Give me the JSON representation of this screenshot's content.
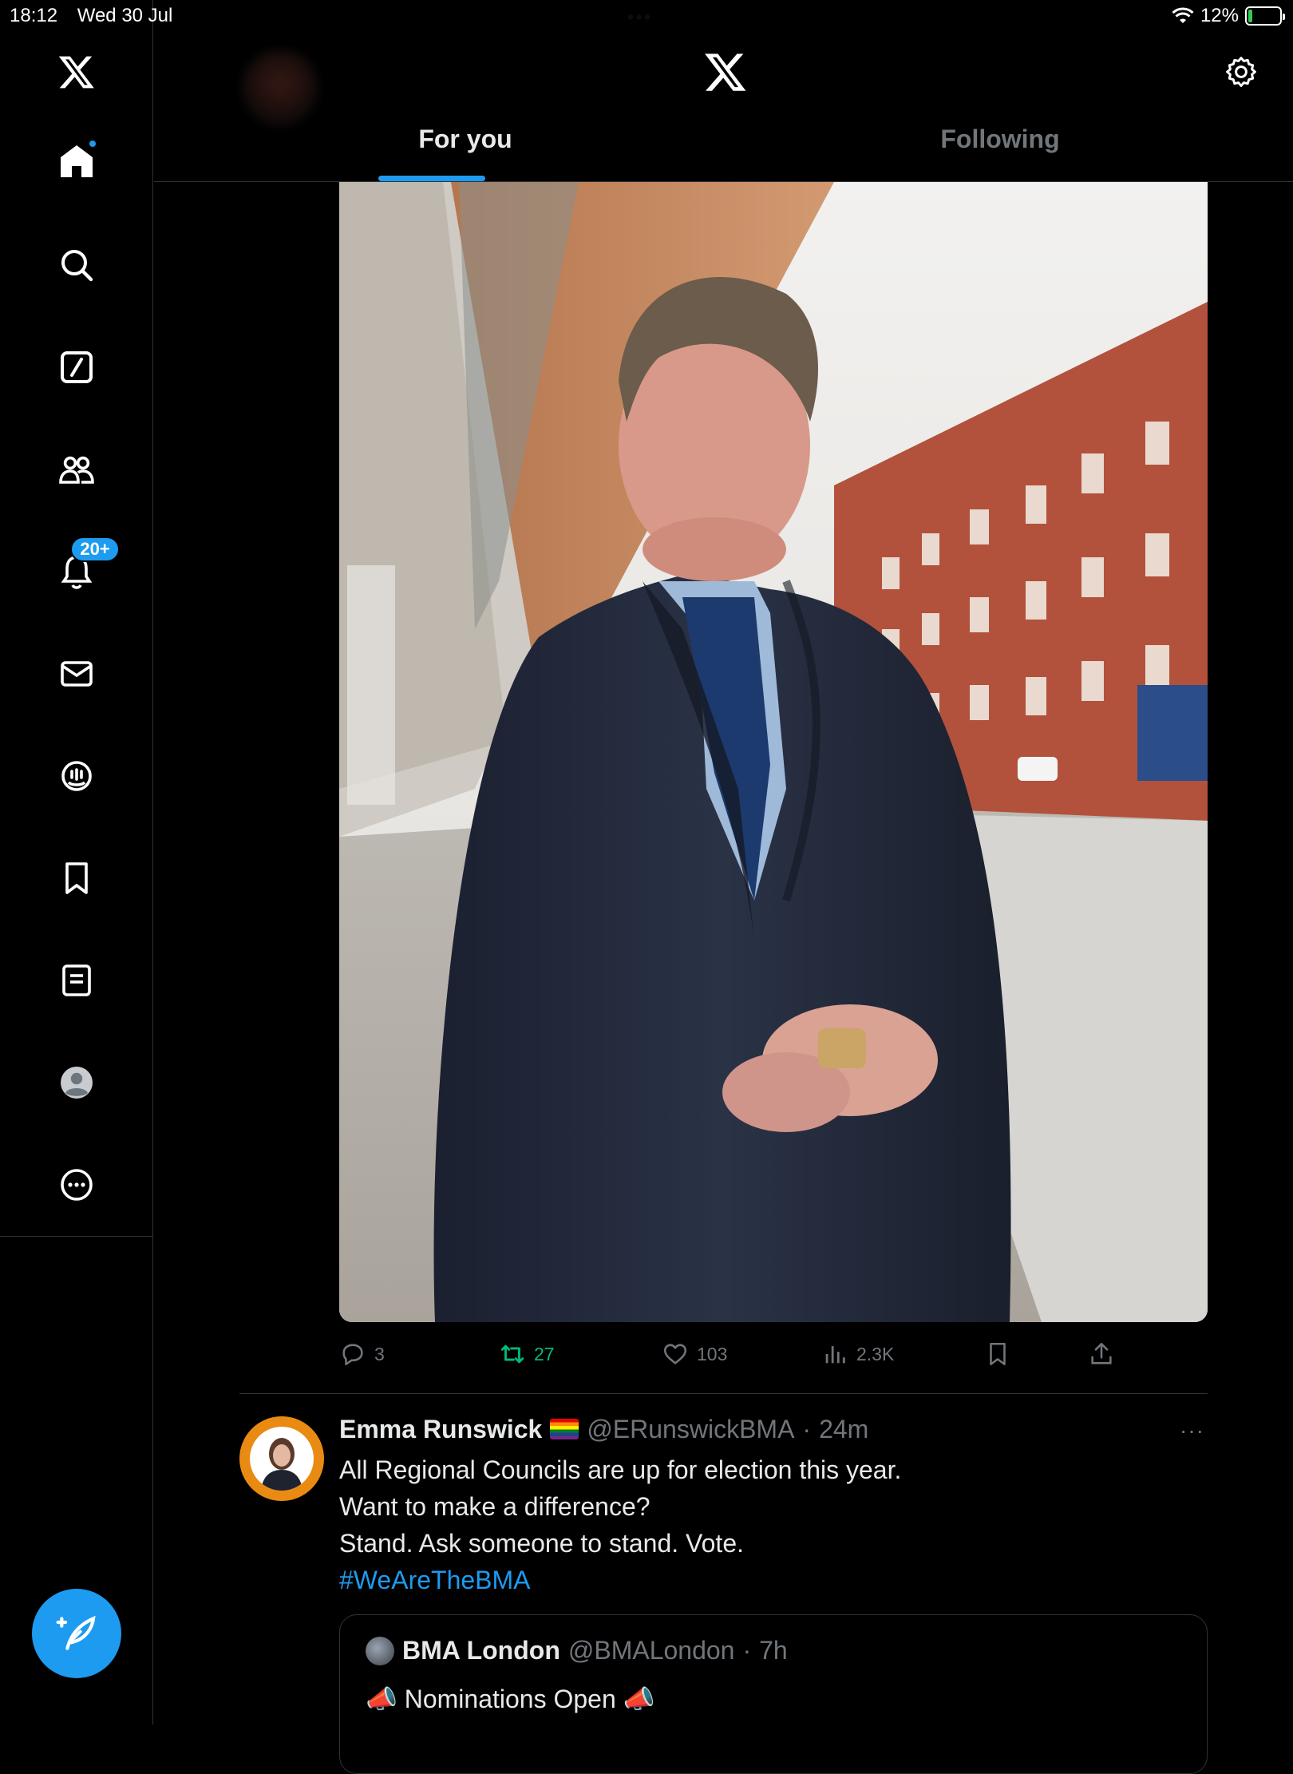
{
  "status_bar": {
    "time": "18:12",
    "date": "Wed 30 Jul",
    "dots": "•••",
    "battery_percent": "12%",
    "battery_level": 0.12
  },
  "sidebar": {
    "items": [
      {
        "name": "logo",
        "icon": "x-logo-icon"
      },
      {
        "name": "home",
        "icon": "home-icon",
        "has_dot": true
      },
      {
        "name": "explore",
        "icon": "search-icon"
      },
      {
        "name": "grok",
        "icon": "grok-icon"
      },
      {
        "name": "communities",
        "icon": "people-icon"
      },
      {
        "name": "notifications",
        "icon": "bell-icon",
        "badge": "20+"
      },
      {
        "name": "messages",
        "icon": "mail-icon"
      },
      {
        "name": "spaces",
        "icon": "spaces-icon"
      },
      {
        "name": "bookmarks",
        "icon": "bookmark-icon"
      },
      {
        "name": "lists",
        "icon": "list-icon"
      },
      {
        "name": "profile",
        "icon": "avatar-icon"
      },
      {
        "name": "more",
        "icon": "more-circle-icon"
      }
    ],
    "compose_icon": "compose-feather-icon"
  },
  "header": {
    "logo_icon": "x-logo-icon",
    "settings_icon": "gear-icon",
    "tabs": [
      {
        "label": "For you",
        "active": true
      },
      {
        "label": "Following",
        "active": false
      }
    ]
  },
  "post_actions": {
    "replies": "3",
    "reposts": "27",
    "likes": "103",
    "views": "2.3K"
  },
  "colors": {
    "accent": "#1d9bf0",
    "repost_active": "#00ba7c",
    "muted": "#71767b",
    "background": "#000000"
  },
  "tweet": {
    "name": "Emma Runswick",
    "flag_icon": "rainbow-flag-icon",
    "handle": "@ERunswickBMA",
    "separator": "·",
    "time": "24m",
    "more": "···",
    "lines": [
      "All Regional Councils are up for election this year.",
      "Want to make a difference?",
      "Stand. Ask someone to stand. Vote."
    ],
    "hashtag": "#WeAreTheBMA",
    "quoted": {
      "name": "BMA London",
      "handle": "@BMALondon",
      "separator": "·",
      "time": "7h",
      "text": "📣 Nominations Open 📣"
    }
  }
}
